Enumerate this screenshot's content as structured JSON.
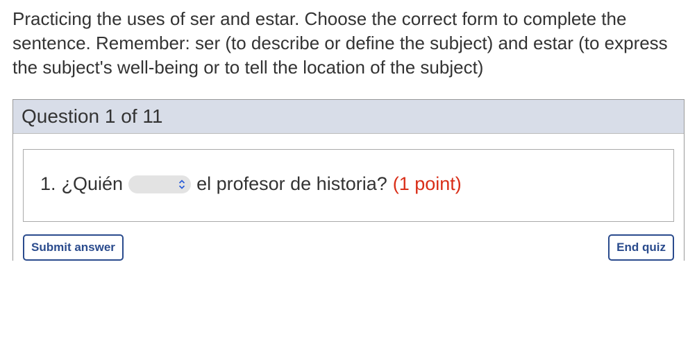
{
  "instructions": "Practicing the uses of ser and estar. Choose the correct form to complete the sentence. Remember: ser (to describe or define the subject) and estar (to express the subject's well-being or to tell the location of the subject)",
  "question_header": "Question 1 of 11",
  "question": {
    "number": "1.",
    "prefix": "¿Quién",
    "suffix": "el profesor de historia?",
    "points": "(1 point)"
  },
  "buttons": {
    "submit": "Submit answer",
    "end": "End quiz"
  }
}
